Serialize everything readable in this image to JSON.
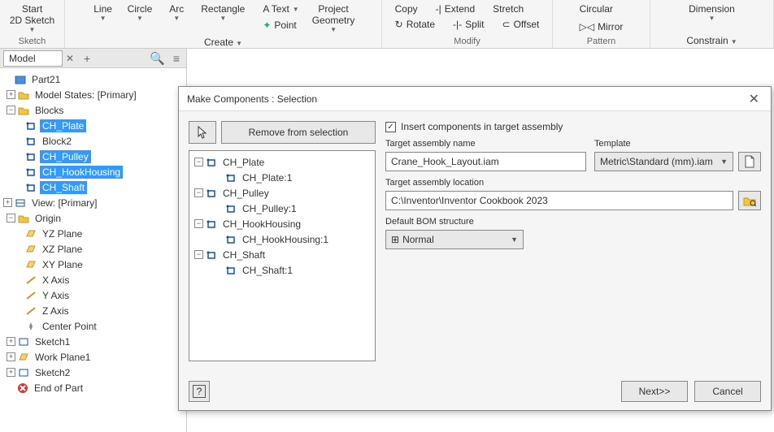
{
  "ribbon": {
    "sketch_group_label": "Sketch",
    "start_2d_sketch": "Start\n2D Sketch",
    "create_group_label": "Create",
    "line": "Line",
    "circle": "Circle",
    "arc": "Arc",
    "rectangle": "Rectangle",
    "point": "Point",
    "project_geometry": "Project\nGeometry",
    "modify_group_label": "Modify",
    "copy": "Copy",
    "rotate": "Rotate",
    "extend": "Extend",
    "split": "Split",
    "stretch": "Stretch",
    "offset": "Offset",
    "circular": "Circular",
    "mirror": "Mirror",
    "pattern_group_label": "Pattern",
    "dimension": "Dimension",
    "constrain_group_label": "Constrain"
  },
  "browser": {
    "tab": "Model",
    "root": "Part21",
    "model_states": "Model States: [Primary]",
    "blocks": "Blocks",
    "block_items": [
      "CH_Plate",
      "Block2",
      "CH_Pulley",
      "CH_HookHousing",
      "CH_Shaft"
    ],
    "block_selected": [
      true,
      false,
      true,
      true,
      true
    ],
    "view": "View: [Primary]",
    "origin": "Origin",
    "origin_items": [
      "YZ Plane",
      "XZ Plane",
      "XY Plane",
      "X Axis",
      "Y Axis",
      "Z Axis",
      "Center Point"
    ],
    "sketch1": "Sketch1",
    "work_plane1": "Work Plane1",
    "sketch2": "Sketch2",
    "end_of_part": "End of Part"
  },
  "dialog": {
    "title": "Make Components : Selection",
    "remove_btn": "Remove from selection",
    "tree": [
      {
        "name": "CH_Plate",
        "children": [
          "CH_Plate:1"
        ]
      },
      {
        "name": "CH_Pulley",
        "children": [
          "CH_Pulley:1"
        ]
      },
      {
        "name": "CH_HookHousing",
        "children": [
          "CH_HookHousing:1"
        ]
      },
      {
        "name": "CH_Shaft",
        "children": [
          "CH_Shaft:1"
        ]
      }
    ],
    "insert_chk_label": "Insert components in target assembly",
    "insert_checked": true,
    "target_name_label": "Target assembly name",
    "target_name_value": "Crane_Hook_Layout.iam",
    "template_label": "Template",
    "template_value": "Metric\\Standard (mm).iam",
    "location_label": "Target assembly location",
    "location_value": "C:\\Inventor\\Inventor Cookbook 2023",
    "bom_label": "Default BOM structure",
    "bom_value": "Normal",
    "next_btn": "Next>>",
    "cancel_btn": "Cancel"
  }
}
